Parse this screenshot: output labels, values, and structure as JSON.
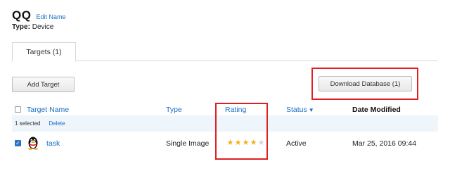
{
  "header": {
    "database_name": "QQ",
    "edit_label": "Edit Name",
    "type_label": "Type:",
    "type_value": "Device"
  },
  "tabs": [
    {
      "label": "Targets (1)",
      "active": true
    }
  ],
  "toolbar": {
    "add_label": "Add Target",
    "download_label": "Download Database (1)"
  },
  "table": {
    "columns": {
      "name": "Target Name",
      "type": "Type",
      "rating": "Rating",
      "status": "Status",
      "date": "Date Modified"
    },
    "selection": {
      "count_text": "1 selected",
      "delete_label": "Delete"
    },
    "rows": [
      {
        "checked": true,
        "icon": "penguin-icon",
        "name": "task",
        "type": "Single Image",
        "rating": 4,
        "rating_max": 5,
        "status": "Active",
        "date": "Mar 25, 2016 09:44"
      }
    ]
  },
  "colors": {
    "link": "#1a6fc4",
    "highlight": "#e02020",
    "star_on": "#f2b01e",
    "star_off": "#d5d5d5",
    "selection_bg": "#eef5fb"
  }
}
